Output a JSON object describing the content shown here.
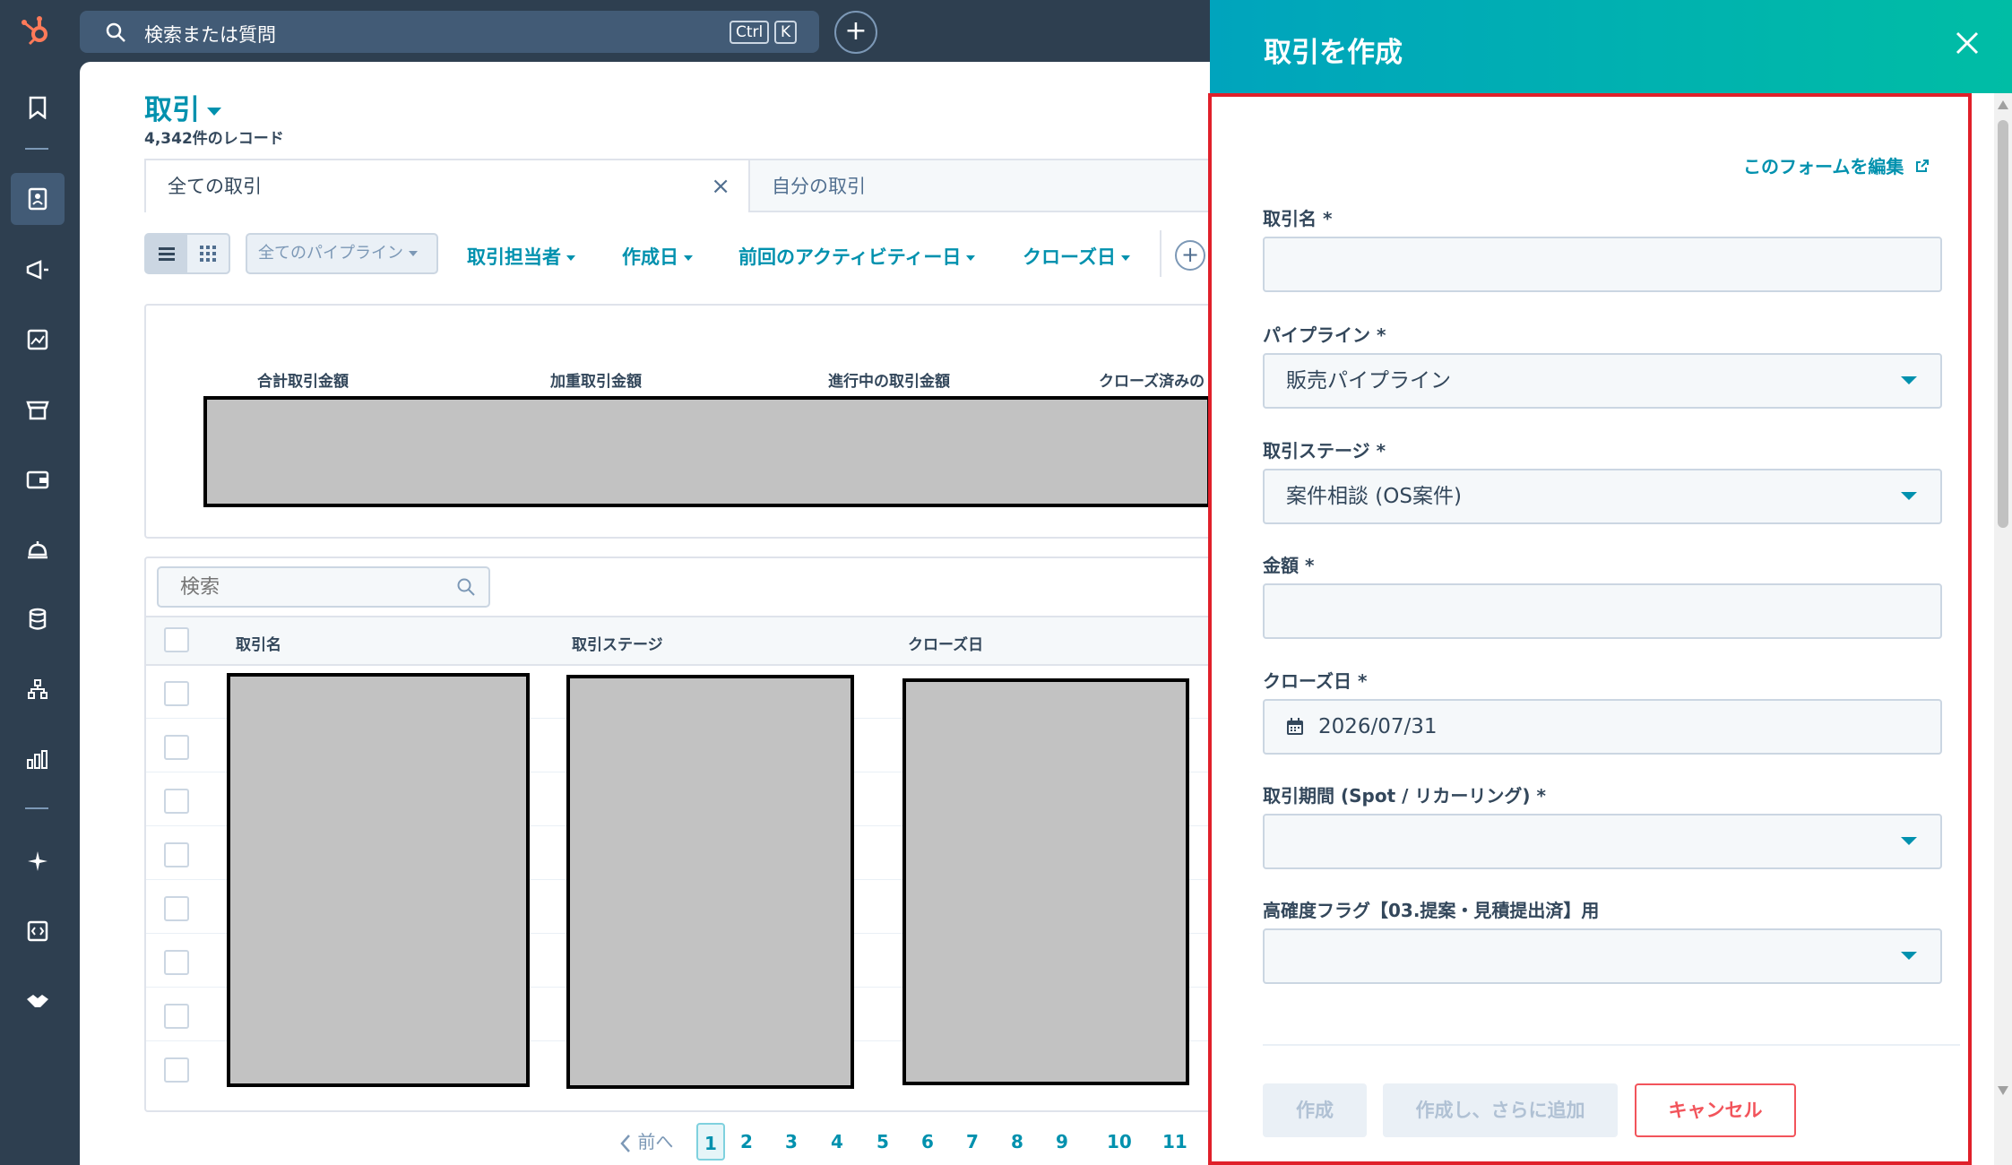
{
  "topbar": {
    "search_placeholder": "検索または質問",
    "shortcut_ctrl": "Ctrl",
    "shortcut_key": "K",
    "add_label": "+"
  },
  "header": {
    "title": "取引",
    "record_count": "4,342件のレコード"
  },
  "tabs": [
    {
      "label": "全ての取引",
      "close": "×"
    },
    {
      "label": "自分の取引"
    }
  ],
  "filters": {
    "pipeline": "全てのパイプライン",
    "items": [
      "取引担当者",
      "作成日",
      "前回のアクティビティー日",
      "クローズ日"
    ],
    "add": "+"
  },
  "summary": {
    "labels": [
      "合計取引金額",
      "加重取引金額",
      "進行中の取引金額",
      "クローズ済みの"
    ]
  },
  "table": {
    "search_placeholder": "検索",
    "columns": [
      "取引名",
      "取引ステージ",
      "クローズ日"
    ]
  },
  "pagination": {
    "prev": "前へ",
    "pages": [
      "1",
      "2",
      "3",
      "4",
      "5",
      "6",
      "7",
      "8",
      "9",
      "10",
      "11"
    ],
    "current": "1"
  },
  "panel": {
    "title": "取引を作成",
    "edit_form_link": "このフォームを編集",
    "fields": [
      {
        "label": "取引名 *",
        "value": "",
        "type": "text"
      },
      {
        "label": "パイプライン *",
        "value": "販売パイプライン",
        "type": "select"
      },
      {
        "label": "取引ステージ *",
        "value": "案件相談 (OS案件)",
        "type": "select"
      },
      {
        "label": "金額 *",
        "value": "",
        "type": "text"
      },
      {
        "label": "クローズ日 *",
        "value": "2026/07/31",
        "type": "date"
      },
      {
        "label": "取引期間 (Spot / リカーリング) *",
        "value": "",
        "type": "select"
      },
      {
        "label": "高確度フラグ【03.提案・見積提出済】用",
        "value": "",
        "type": "select"
      }
    ],
    "buttons": {
      "create": "作成",
      "create_and_add": "作成し、さらに追加",
      "cancel": "キャンセル"
    }
  },
  "colors": {
    "accent": "#0091ae",
    "nav_bg": "#2e3f50",
    "header_gradient_start": "#00a4bd",
    "header_gradient_end": "#00bda5",
    "highlight_border": "#e0202a",
    "cancel": "#f2545b"
  }
}
